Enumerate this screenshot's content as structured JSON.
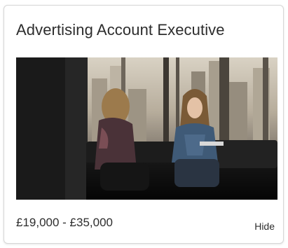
{
  "job_card": {
    "title": "Advertising Account Executive",
    "salary": "£19,000 - £35,000",
    "hide_label": "Hide",
    "image": {
      "subject": "office-meeting-photo"
    },
    "colors": {
      "text": "#2d2d2d",
      "border": "#d6d6d6",
      "background": "#ffffff"
    }
  }
}
